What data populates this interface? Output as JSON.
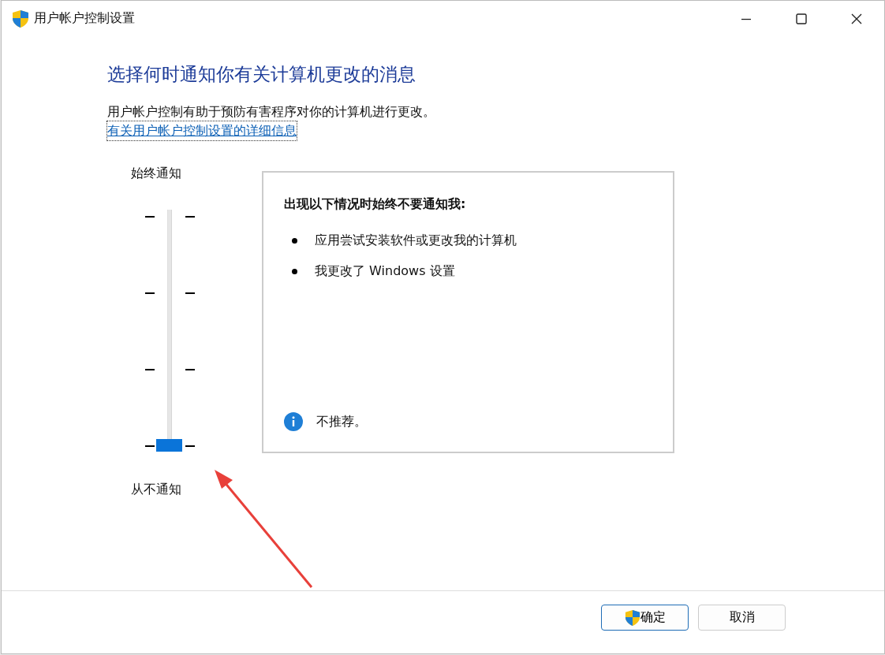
{
  "window": {
    "title": "用户帐户控制设置"
  },
  "heading": "选择何时通知你有关计算机更改的消息",
  "description": "用户帐户控制有助于预防有害程序对你的计算机进行更改。",
  "link": "有关用户帐户控制设置的详细信息",
  "slider": {
    "top_label": "始终通知",
    "bottom_label": "从不通知",
    "level": 0
  },
  "info_panel": {
    "title": "出现以下情况时始终不要通知我:",
    "bullets": [
      "应用尝试安装软件或更改我的计算机",
      "我更改了 Windows 设置"
    ],
    "note": "不推荐。"
  },
  "buttons": [
    {
      "label": "确定",
      "kind": "shield"
    },
    {
      "label": "取消",
      "kind": "plain"
    }
  ]
}
